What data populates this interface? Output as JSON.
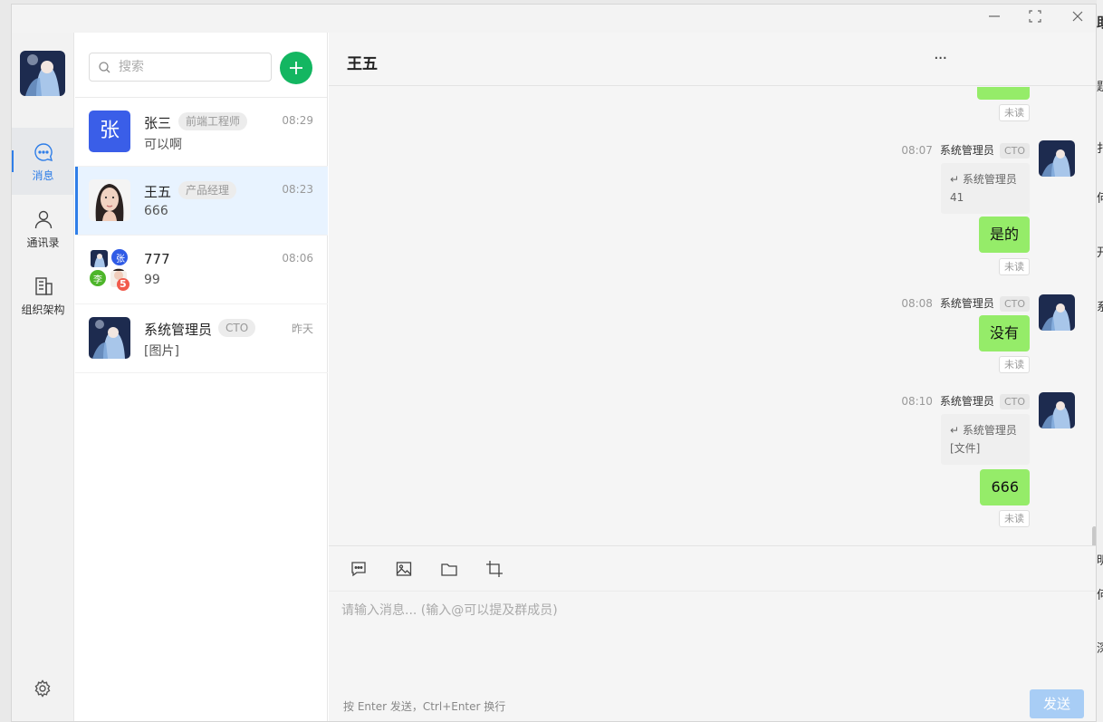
{
  "window": {
    "min_icon": "minimize-icon",
    "max_icon": "maximize-icon",
    "close_icon": "close-icon"
  },
  "rail": {
    "items": [
      {
        "label": "消息",
        "icon": "message-icon",
        "active": true
      },
      {
        "label": "通讯录",
        "icon": "contacts-icon",
        "active": false
      },
      {
        "label": "组织架构",
        "icon": "organization-icon",
        "active": false
      }
    ],
    "settings_icon": "gear-icon"
  },
  "search": {
    "placeholder": "搜索",
    "value": ""
  },
  "conversations": [
    {
      "name": "张三",
      "tag": "前端工程师",
      "time": "08:29",
      "preview": "可以啊",
      "avatar_text": "张"
    },
    {
      "name": "王五",
      "tag": "产品经理",
      "time": "08:23",
      "preview": "666"
    },
    {
      "name": "777",
      "time": "08:06",
      "preview": "99",
      "group_avatar": {
        "badge_zhang": "张",
        "badge_li": "李",
        "unread": "5"
      }
    },
    {
      "name": "系统管理员",
      "tag": "CTO",
      "time": "昨天",
      "preview": "[图片]"
    }
  ],
  "chat": {
    "title": "王五",
    "more": "···",
    "messages": [
      {
        "unread": "未读"
      },
      {
        "time": "08:07",
        "sender": "系统管理员",
        "role": "CTO",
        "quote_sender": "系统管理员",
        "quote_text": "41",
        "text": "是的",
        "unread": "未读"
      },
      {
        "time": "08:08",
        "sender": "系统管理员",
        "role": "CTO",
        "text": "没有",
        "unread": "未读"
      },
      {
        "time": "08:10",
        "sender": "系统管理员",
        "role": "CTO",
        "quote_sender": "系统管理员",
        "quote_text": "[文件]",
        "text": "666",
        "unread": "未读"
      }
    ]
  },
  "composer": {
    "tools": [
      "comment-icon",
      "image-icon",
      "folder-icon",
      "crop-icon"
    ],
    "placeholder": "请输入消息... (输入@可以提及群成员)",
    "hint": "按 Enter 发送，Ctrl+Enter 换行",
    "send_label": "发送"
  },
  "background_chars": [
    "助",
    "题",
    "扌",
    "何",
    "开",
    "系",
    "明",
    "何",
    "深"
  ]
}
